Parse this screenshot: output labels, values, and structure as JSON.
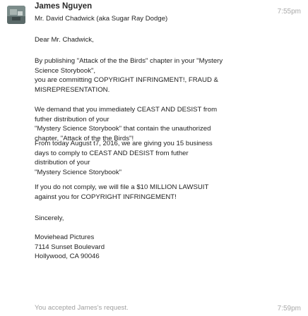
{
  "message": {
    "sender": "James Nguyen",
    "time": "7:55pm",
    "paragraphs": [
      [
        "Mr. David Chadwick (aka Sugar Ray Dodge)"
      ],
      [
        "Dear Mr. Chadwick,"
      ],
      [
        "By publishing \"Attack of the the Birds\" chapter in your \"Mystery",
        "Science Storybook\",",
        "you are committing COPYRIGHT INFRINGMENT!, FRAUD &",
        "MISREPRESENTATION."
      ],
      [
        "We demand that you immediately CEAST AND DESIST from",
        "futher distribution of your",
        "\"Mystery Science Storybook\" that contain the unauthorized",
        "chapter, \"Attack of the the Birds\"!"
      ],
      [
        "From today August t7, 2016, we are giving you 15 business",
        "days to comply to CEAST AND DESIST from futher",
        "distribution of your",
        "\"Mystery Science Storybook\""
      ],
      [
        "If you do not comply, we will file a $10 MILLION LAWSUIT",
        "against you for COPYRIGHT INFRINGEMENT!"
      ],
      [
        "Sincerely,"
      ],
      [
        "Moviehead Pictures",
        "7114 Sunset Boulevard",
        "Hollywood, CA 90046"
      ]
    ]
  },
  "status": {
    "text": "You accepted James's request.",
    "time": "7:59pm"
  }
}
